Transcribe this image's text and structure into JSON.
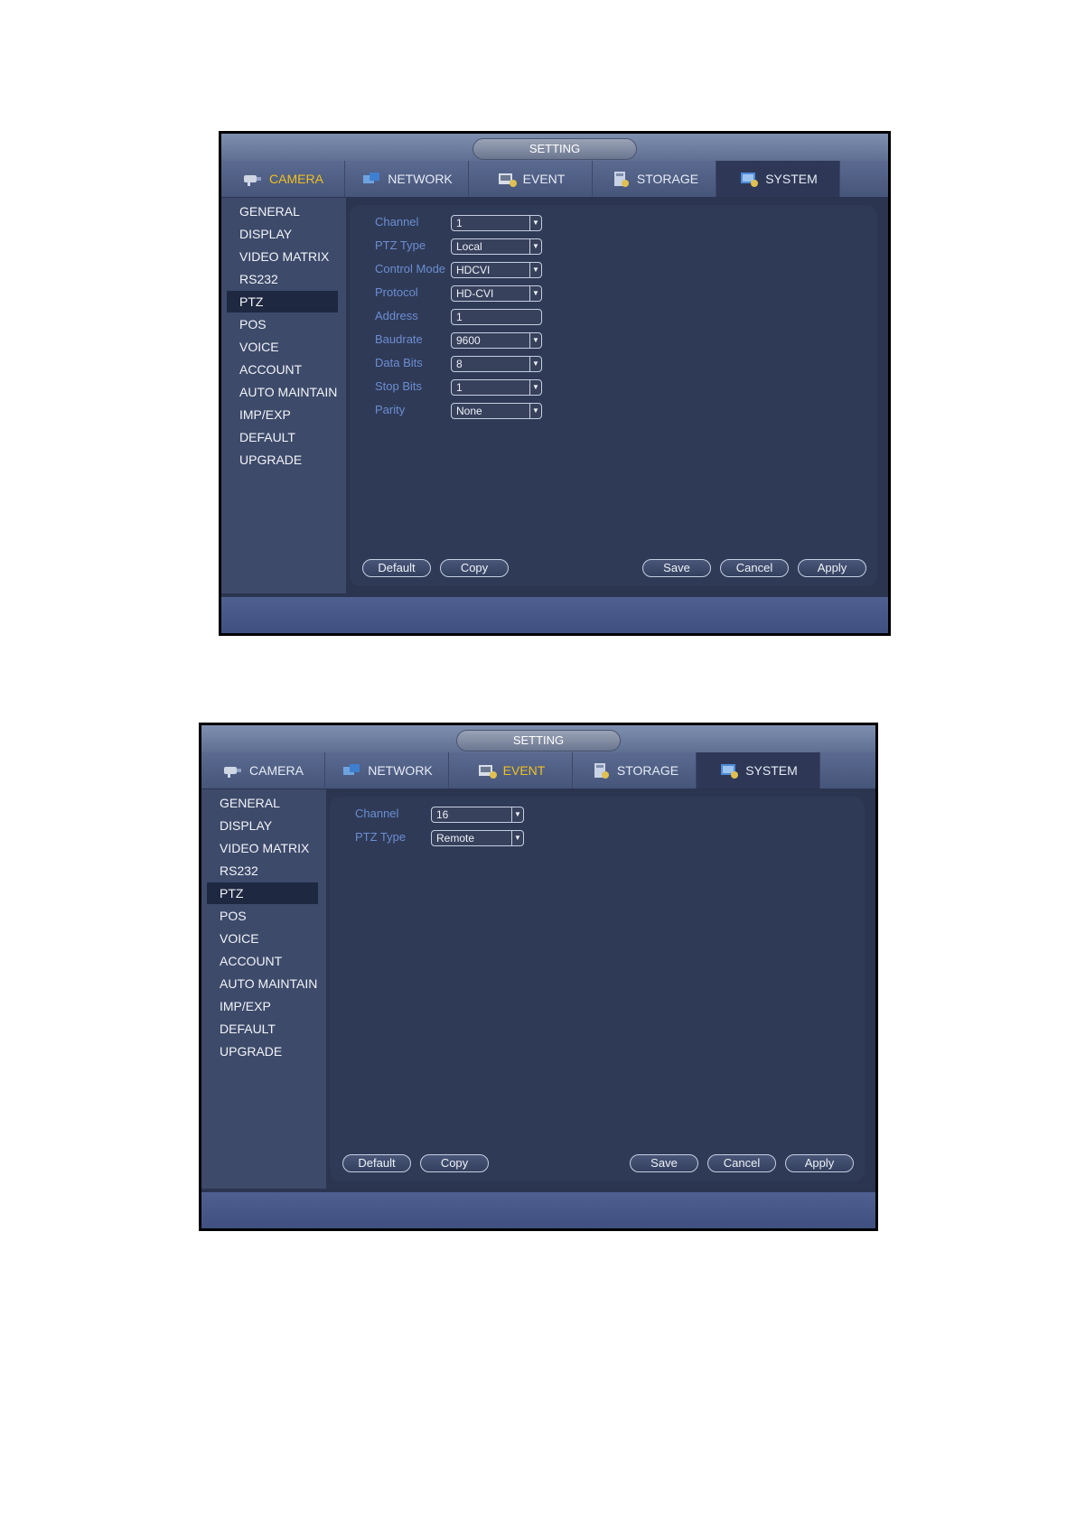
{
  "window1": {
    "title": "SETTING",
    "tabs": [
      {
        "label": "CAMERA",
        "icon": "camera-icon"
      },
      {
        "label": "NETWORK",
        "icon": "network-icon"
      },
      {
        "label": "EVENT",
        "icon": "event-icon"
      },
      {
        "label": "STORAGE",
        "icon": "storage-icon"
      },
      {
        "label": "SYSTEM",
        "icon": "system-icon"
      }
    ],
    "sidebar": [
      "GENERAL",
      "DISPLAY",
      "VIDEO MATRIX",
      "RS232",
      "PTZ",
      "POS",
      "VOICE",
      "ACCOUNT",
      "AUTO MAINTAIN",
      "IMP/EXP",
      "DEFAULT",
      "UPGRADE"
    ],
    "fields": [
      {
        "label": "Channel",
        "value": "1"
      },
      {
        "label": "PTZ Type",
        "value": "Local"
      },
      {
        "label": "Control Mode",
        "value": "HDCVI"
      },
      {
        "label": "Protocol",
        "value": "HD-CVI"
      },
      {
        "label": "Address",
        "value": "1"
      },
      {
        "label": "Baudrate",
        "value": "9600"
      },
      {
        "label": "Data Bits",
        "value": "8"
      },
      {
        "label": "Stop Bits",
        "value": "1"
      },
      {
        "label": "Parity",
        "value": "None"
      }
    ],
    "buttons": {
      "default": "Default",
      "copy": "Copy",
      "save": "Save",
      "cancel": "Cancel",
      "apply": "Apply"
    }
  },
  "window2": {
    "title": "SETTING",
    "tabs": [
      {
        "label": "CAMERA",
        "icon": "camera-icon"
      },
      {
        "label": "NETWORK",
        "icon": "network-icon"
      },
      {
        "label": "EVENT",
        "icon": "event-icon"
      },
      {
        "label": "STORAGE",
        "icon": "storage-icon"
      },
      {
        "label": "SYSTEM",
        "icon": "system-icon"
      }
    ],
    "sidebar": [
      "GENERAL",
      "DISPLAY",
      "VIDEO MATRIX",
      "RS232",
      "PTZ",
      "POS",
      "VOICE",
      "ACCOUNT",
      "AUTO MAINTAIN",
      "IMP/EXP",
      "DEFAULT",
      "UPGRADE"
    ],
    "fields": [
      {
        "label": "Channel",
        "value": "16"
      },
      {
        "label": "PTZ Type",
        "value": "Remote"
      }
    ],
    "buttons": {
      "default": "Default",
      "copy": "Copy",
      "save": "Save",
      "cancel": "Cancel",
      "apply": "Apply"
    }
  },
  "colors": {
    "highlight": "#f0c020",
    "field_label": "#6c8ed0",
    "panel": "#2f3a57"
  }
}
